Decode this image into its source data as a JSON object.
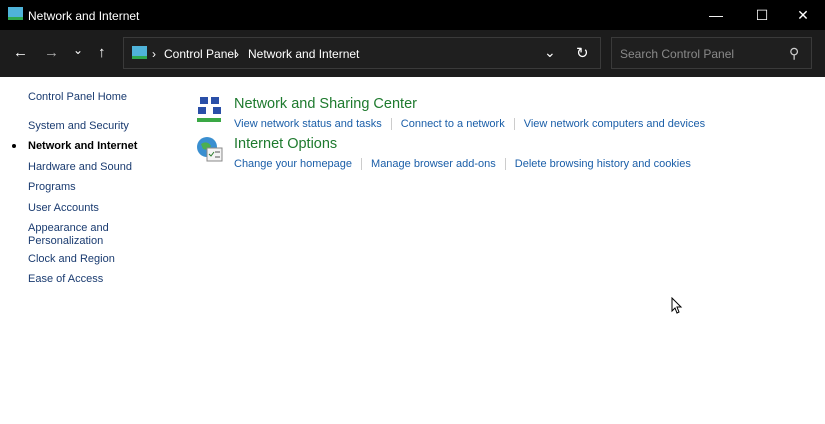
{
  "window": {
    "title": "Network and Internet",
    "minimize": "—",
    "maximize": "☐",
    "close": "✕"
  },
  "nav": {
    "back": "←",
    "forward": "→",
    "recent": "⌄",
    "up": "↑"
  },
  "address": {
    "crumbs": [
      "Control Panel",
      "Network and Internet"
    ],
    "sep": "›",
    "dropdown": "⌄",
    "refresh": "↻"
  },
  "search": {
    "placeholder": "Search Control Panel",
    "icon": "⚲"
  },
  "sidebar": {
    "items": [
      {
        "label": "Control Panel Home"
      },
      {
        "label": "System and Security"
      },
      {
        "label": "Network and Internet",
        "active": true
      },
      {
        "label": "Hardware and Sound"
      },
      {
        "label": "Programs"
      },
      {
        "label": "User Accounts"
      },
      {
        "label": "Appearance and Personalization"
      },
      {
        "label": "Clock and Region"
      },
      {
        "label": "Ease of Access"
      }
    ]
  },
  "categories": [
    {
      "title": "Network and Sharing Center",
      "links": [
        "View network status and tasks",
        "Connect to a network",
        "View network computers and devices"
      ]
    },
    {
      "title": "Internet Options",
      "links": [
        "Change your homepage",
        "Manage browser add-ons",
        "Delete browsing history and cookies"
      ]
    }
  ]
}
